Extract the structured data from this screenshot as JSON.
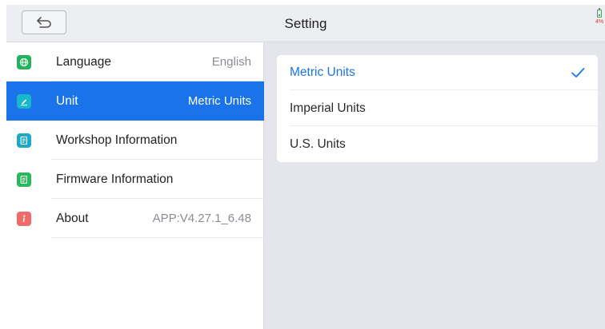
{
  "header": {
    "title": "Setting",
    "back_icon": "back-arrow-icon",
    "battery_percent": "4%"
  },
  "sidebar": {
    "items": [
      {
        "label": "Language",
        "value": "English",
        "icon": "globe-icon",
        "icon_color": "#22b35e",
        "active": false
      },
      {
        "label": "Unit",
        "value": "Metric Units",
        "icon": "pencil-icon",
        "icon_color": "#17b8c9",
        "active": true
      },
      {
        "label": "Workshop Information",
        "value": "",
        "icon": "document-icon",
        "icon_color": "#1fa9c9",
        "active": false
      },
      {
        "label": "Firmware Information",
        "value": "",
        "icon": "firmware-doc-icon",
        "icon_color": "#26b85a",
        "active": false
      },
      {
        "label": "About",
        "value": "APP:V4.27.1_6.48",
        "icon": "info-icon",
        "icon_color": "#f06a6a",
        "active": false
      }
    ]
  },
  "unit_options": {
    "selected_index": 0,
    "items": [
      {
        "label": "Metric Units"
      },
      {
        "label": "Imperial Units"
      },
      {
        "label": "U.S. Units"
      }
    ]
  },
  "colors": {
    "accent": "#1a73e8",
    "background": "#e4e6eb"
  }
}
